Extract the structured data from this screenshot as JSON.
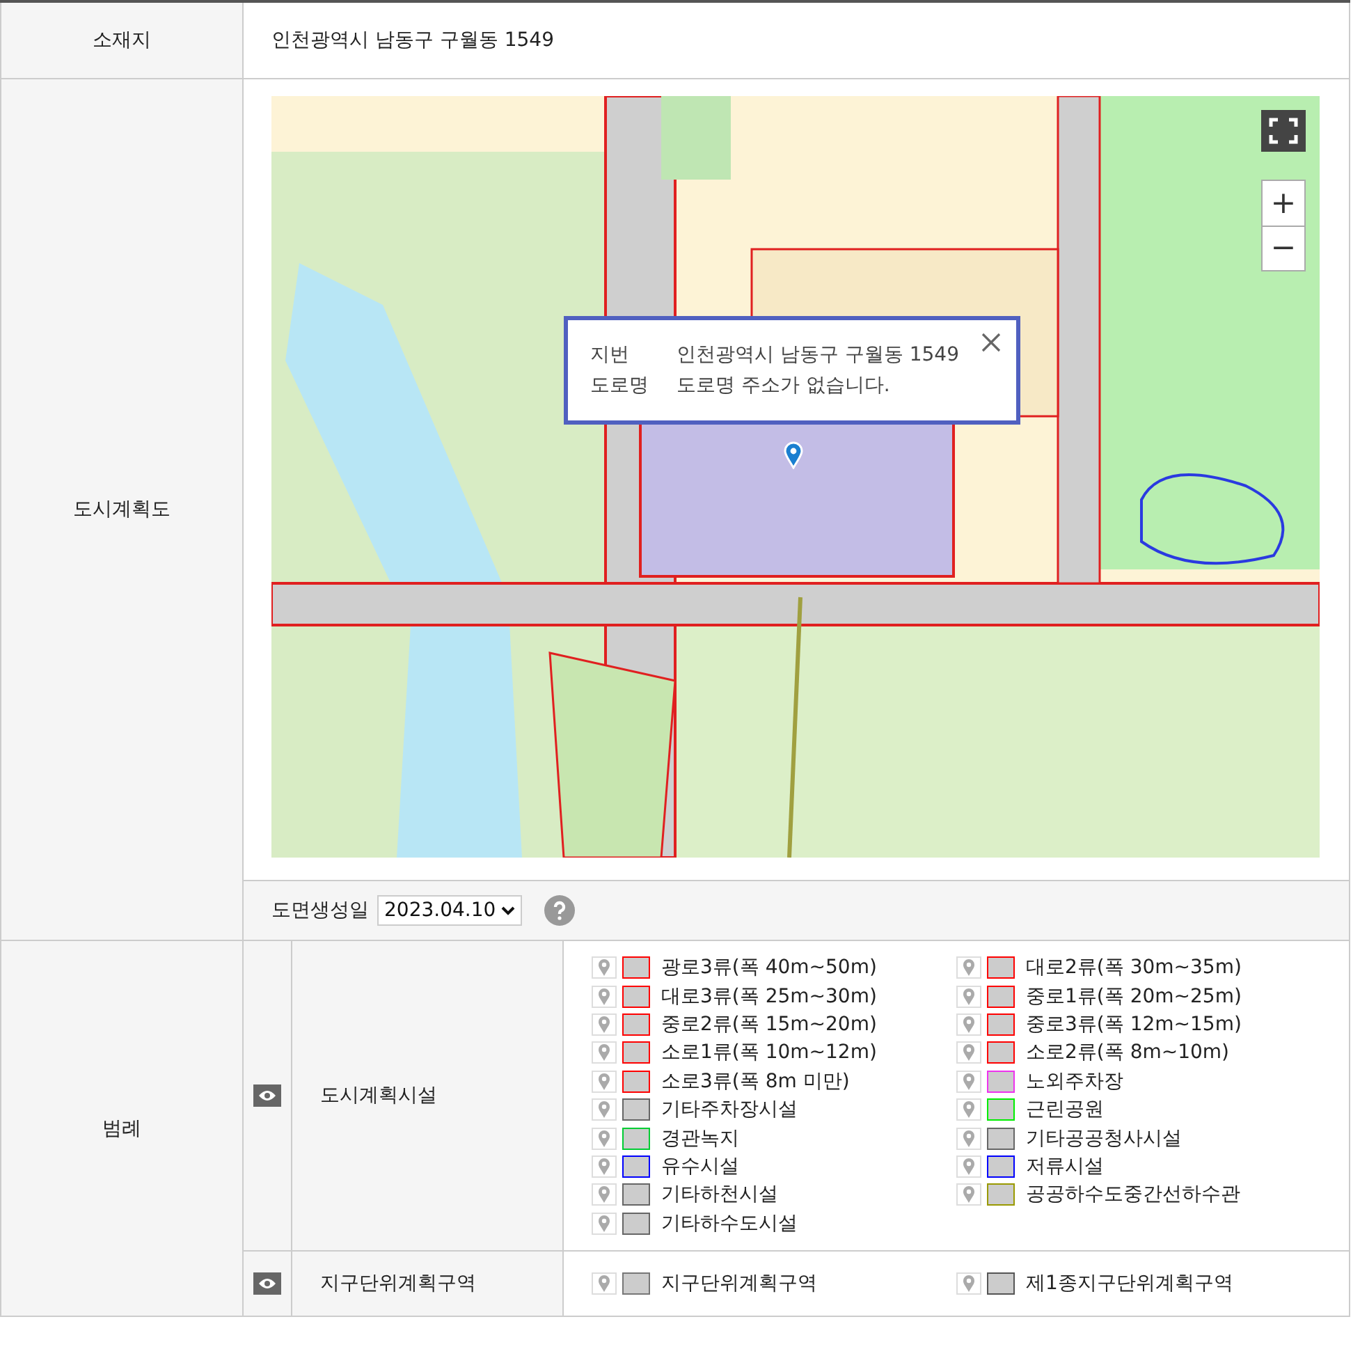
{
  "location": {
    "label": "소재지",
    "value": "인천광역시 남동구 구월동 1549"
  },
  "plan_map": {
    "label": "도시계획도",
    "kind": "picture",
    "popup": {
      "rows": [
        {
          "key": "지번",
          "value": "인천광역시 남동구 구월동 1549"
        },
        {
          "key": "도로명",
          "value": "도로명 주소가 없습니다."
        }
      ]
    },
    "zoom_in": "+",
    "zoom_out": "−",
    "date_label": "도면생성일",
    "date_value": "2023.04.10"
  },
  "legend": {
    "label": "범례",
    "groups": [
      {
        "name": "도시계획시설",
        "items": [
          {
            "label": "광로3류(폭 40m~50m)",
            "color": "#ff0000"
          },
          {
            "label": "대로2류(폭 30m~35m)",
            "color": "#ff0000"
          },
          {
            "label": "대로3류(폭 25m~30m)",
            "color": "#ff0000"
          },
          {
            "label": "중로1류(폭 20m~25m)",
            "color": "#ff0000"
          },
          {
            "label": "중로2류(폭 15m~20m)",
            "color": "#ff0000"
          },
          {
            "label": "중로3류(폭 12m~15m)",
            "color": "#ff0000"
          },
          {
            "label": "소로1류(폭 10m~12m)",
            "color": "#ff0000"
          },
          {
            "label": "소로2류(폭 8m~10m)",
            "color": "#ff0000"
          },
          {
            "label": "소로3류(폭 8m 미만)",
            "color": "#ff0000"
          },
          {
            "label": "노외주차장",
            "color": "#ee33ee"
          },
          {
            "label": "기타주차장시설",
            "color": "#666666"
          },
          {
            "label": "근린공원",
            "color": "#00ee00"
          },
          {
            "label": "경관녹지",
            "color": "#00cc33"
          },
          {
            "label": "기타공공청사시설",
            "color": "#666666"
          },
          {
            "label": "유수시설",
            "color": "#0000ff"
          },
          {
            "label": "저류시설",
            "color": "#0000ff"
          },
          {
            "label": "기타하천시설",
            "color": "#666666"
          },
          {
            "label": "공공하수도중간선하수관",
            "color": "#999900"
          },
          {
            "label": "기타하수도시설",
            "color": "#666666"
          }
        ]
      },
      {
        "name": "지구단위계획구역",
        "items": [
          {
            "label": "지구단위계획구역",
            "color": "#777777"
          },
          {
            "label": "제1종지구단위계획구역",
            "color": "#555555"
          }
        ]
      }
    ]
  }
}
